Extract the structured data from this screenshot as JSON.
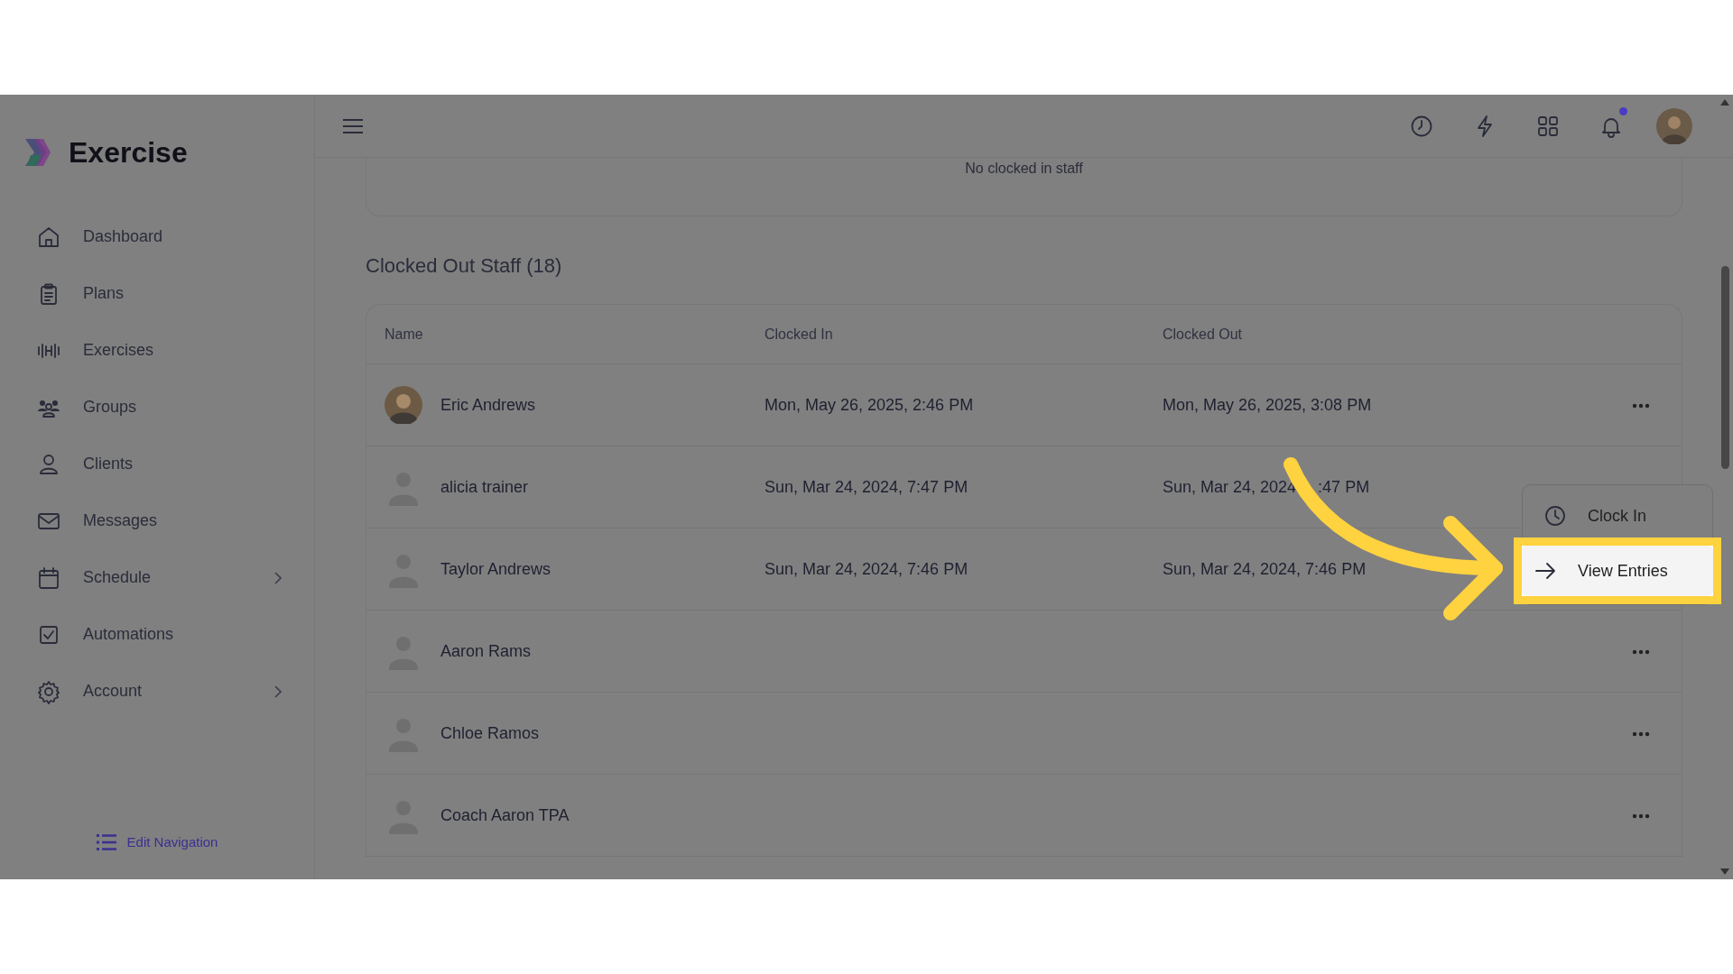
{
  "brand": {
    "name": "Exercise"
  },
  "sidebar": {
    "items": [
      {
        "label": "Dashboard",
        "expandable": false
      },
      {
        "label": "Plans",
        "expandable": false
      },
      {
        "label": "Exercises",
        "expandable": false
      },
      {
        "label": "Groups",
        "expandable": false
      },
      {
        "label": "Clients",
        "expandable": false
      },
      {
        "label": "Messages",
        "expandable": false
      },
      {
        "label": "Schedule",
        "expandable": true
      },
      {
        "label": "Automations",
        "expandable": false
      },
      {
        "label": "Account",
        "expandable": true
      }
    ],
    "footer_link": "Edit Navigation"
  },
  "header": {
    "notification_unread": true
  },
  "clocked_in": {
    "empty_text": "No clocked in staff"
  },
  "clocked_out": {
    "title": "Clocked Out Staff (18)",
    "columns": [
      "Name",
      "Clocked In",
      "Clocked Out"
    ],
    "rows": [
      {
        "kind": "photo",
        "name": "Eric Andrews",
        "clocked_in": "Mon, May 26, 2025, 2:46 PM",
        "clocked_out": "Mon, May 26, 2025, 3:08 PM",
        "menu_button": true
      },
      {
        "kind": "placeholder",
        "name": "alicia trainer",
        "clocked_in": "Sun, Mar 24, 2024, 7:47 PM",
        "clocked_out": "Sun, Mar 24, 2024",
        "clocked_out_tail": ":47 PM",
        "menu_button": false
      },
      {
        "kind": "placeholder",
        "name": "Taylor Andrews",
        "clocked_in": "Sun, Mar 24, 2024, 7:46 PM",
        "clocked_out": "Sun, Mar 24, 2024, 7:46 PM",
        "menu_button": false
      },
      {
        "kind": "placeholder",
        "name": "Aaron Rams",
        "menu_button": true
      },
      {
        "kind": "placeholder",
        "name": "Chloe Ramos",
        "menu_button": true
      },
      {
        "kind": "placeholder",
        "name": "Coach Aaron TPA",
        "menu_button": true
      }
    ]
  },
  "menu": {
    "items": [
      {
        "label": "Clock In",
        "highlighted": false
      },
      {
        "label": "View Entries",
        "highlighted": true
      }
    ]
  }
}
